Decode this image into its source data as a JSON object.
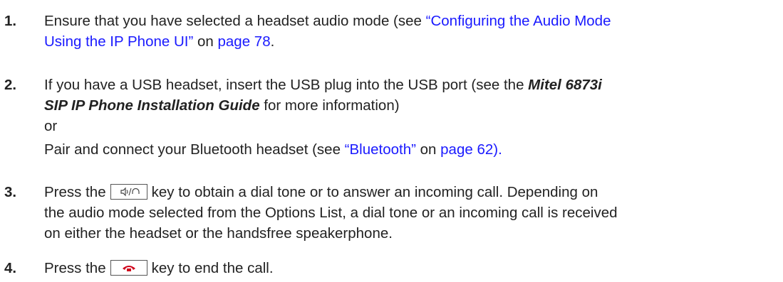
{
  "steps": [
    {
      "number": "1.",
      "pre": "Ensure that you have selected a headset audio mode (see ",
      "link1": "“Configuring the Audio Mode",
      "link1b": "Using the IP Phone UI”",
      "mid": " on ",
      "link2": "page 78",
      "post": "."
    },
    {
      "number": "2.",
      "line1": "If you have a USB headset, insert the USB plug into the USB port (see the ",
      "guide_a": "Mitel 6873i",
      "guide_b": "SIP IP Phone Installation Guide",
      "line2_post": " for more information)",
      "or": "or",
      "pair": "Pair and connect your Bluetooth headset (see ",
      "link_bt": "“Bluetooth”",
      "on": " on ",
      "link_page": "page 62)."
    },
    {
      "number": "3.",
      "pre": "Press the",
      "key_icon": "speaker-headset-key-icon",
      "post": "key to obtain a dial tone or to answer an incoming call. Depending on",
      "line2": "the audio mode selected from the Options List, a dial tone or an incoming call is received",
      "line3": "on either the headset or the handsfree speakerphone."
    },
    {
      "number": "4.",
      "pre": "Press the",
      "key_icon": "hang-up-key-icon",
      "post": "key to end the call."
    }
  ],
  "colors": {
    "link": "#1a1aff",
    "text": "#222222",
    "hangup": "#d0021b"
  }
}
